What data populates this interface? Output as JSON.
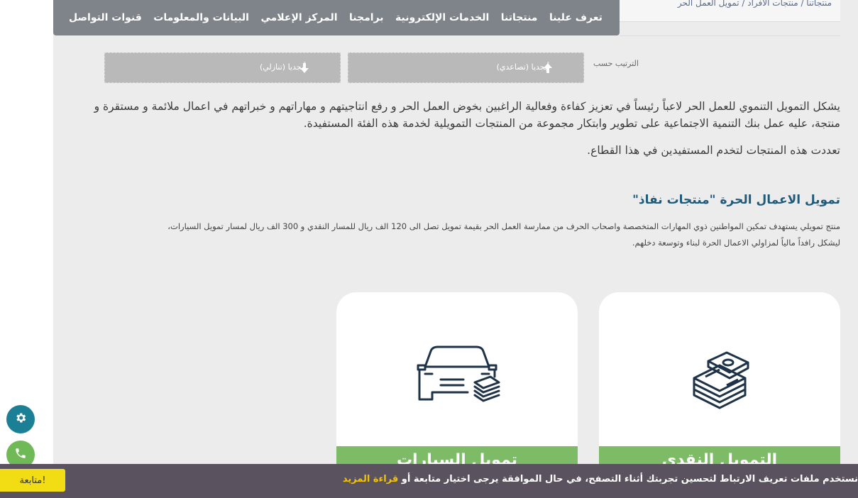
{
  "breadcrumb": "منتجاتنا / منتجات الأفراد / تمويل العمل الحر",
  "nav": {
    "items": [
      "تعرف علينا",
      "منتجاتنا",
      "الخدمات الإلكترونية",
      "برامجنا",
      "المركز الإعلامي",
      "البيانات والمعلومات",
      "قنوات التواصل"
    ]
  },
  "sort": {
    "label": "الترتيب حسب",
    "asc": "أبجديا (تصاعدي)",
    "desc": "أبجديا (تنازلي)"
  },
  "intro": {
    "p1": "يشكل التمويل التنموي للعمل الحر لاعباً رئيساً في تعزيز كفاءة وفعالية الراغبين بخوض العمل الحر و رفع انتاجيتهم و مهاراتهم و خبراتهم في اعمال ملائمة و مستقرة و منتجة، عليه عمل بنك التنمية الاجتماعية على تطوير وابتكار مجموعة من المنتجات التمويلية لخدمة هذه الفئة المستفيدة.",
    "p2": "تعددت هذه المنتجات لتخدم المستفيدين في هذا القطاع."
  },
  "section": {
    "title": "تمويل الاعمال الحرة \"منتجات نفاذ\"",
    "line1": "منتج تمويلي يستهدف تمكين المواطنين ذوي المهارات المتخصصة واصحاب الحرف من ممارسة العمل الحر بقيمة تمويل تصل الى 120 الف ريال للمسار النقدي و 300 الف ريال لمسار تمويل السيارات،",
    "line2": "ليشكل رافداً مالياً لمزاولي الاعمال الحرة لبناء وتوسعة دخلهم."
  },
  "cards": [
    {
      "label": "التمويل النقدي",
      "icon": "cash-stack-icon"
    },
    {
      "label": "تمويل السيارات",
      "icon": "car-money-icon"
    }
  ],
  "fabs": {
    "settings_icon": "gear-icon",
    "phone_icon": "phone-icon"
  },
  "cookie": {
    "text": "نستخدم ملفات تعريف الارتباط لتحسين تجربتك أثناء التصفح، في حال الموافقة يرجى اختيار متابعة أو",
    "link": "قراءة المزيد",
    "accept": "متابعة!"
  },
  "colors": {
    "nav_bg": "#7e8489",
    "accent_green": "#7dbb67",
    "title_blue": "#1f5a7a",
    "fab_teal": "#1b7f95",
    "cookie_bg": "#5a535f",
    "cookie_button": "#f2dc13"
  }
}
